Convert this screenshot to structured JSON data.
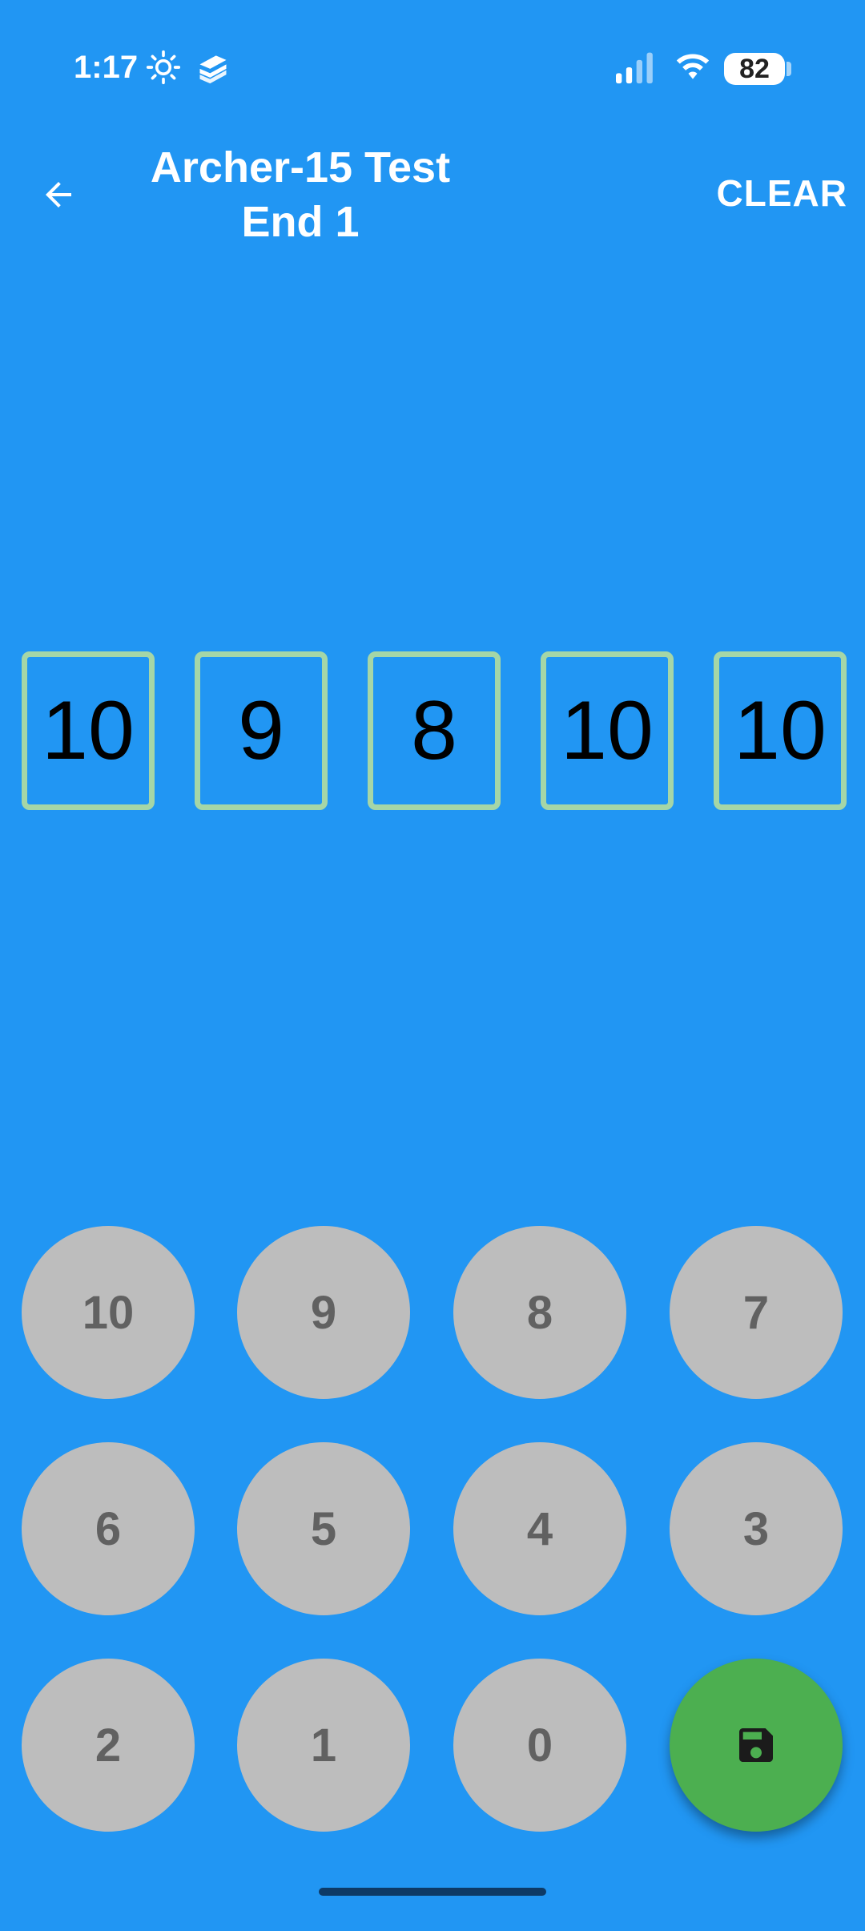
{
  "status_bar": {
    "time": "1:17",
    "battery": "82",
    "icons": [
      "sun-icon",
      "app-notification-icon",
      "signal-icon",
      "wifi-icon",
      "battery-icon"
    ]
  },
  "app_bar": {
    "title_line1": "Archer-15 Test",
    "title_line2": "End 1",
    "clear_label": "CLEAR"
  },
  "scores": [
    "10",
    "9",
    "8",
    "10",
    "10"
  ],
  "keypad": {
    "keys": [
      "10",
      "9",
      "8",
      "7",
      "6",
      "5",
      "4",
      "3",
      "2",
      "1",
      "0"
    ],
    "save_icon": "save-icon"
  },
  "colors": {
    "background": "#2196F3",
    "score_border": "#A5D6A7",
    "key_bg": "#BDBDBD",
    "key_text": "#616161",
    "fab_bg": "#4CAF50"
  }
}
